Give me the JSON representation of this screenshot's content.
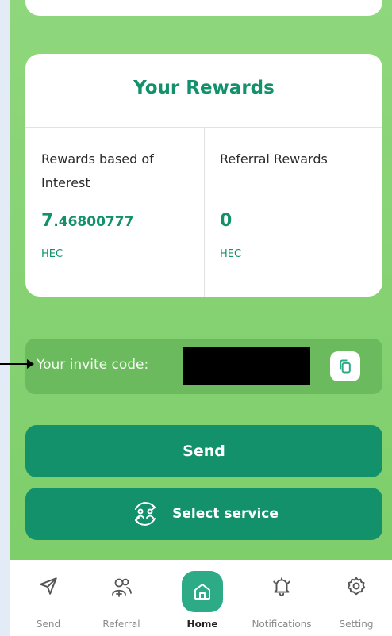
{
  "rewards": {
    "title": "Your Rewards",
    "interest": {
      "label": "Rewards based of Interest",
      "value_int": "7",
      "value_dec": ".46800777",
      "unit": "HEC"
    },
    "referral": {
      "label": "Referral Rewards",
      "value": "0",
      "unit": "HEC"
    }
  },
  "invite": {
    "label": "Your invite code:",
    "copy_icon": "copy-icon"
  },
  "actions": {
    "send_label": "Send",
    "service_label": "Select service",
    "service_icon": "swap-users-icon"
  },
  "nav": {
    "items": [
      {
        "label": "Send",
        "icon": "send-icon"
      },
      {
        "label": "Referral",
        "icon": "add-user-icon"
      },
      {
        "label": "Home",
        "icon": "home-icon",
        "active": true
      },
      {
        "label": "Notifications",
        "icon": "bell-icon"
      },
      {
        "label": "Setting",
        "icon": "gear-icon"
      }
    ]
  },
  "colors": {
    "accent": "#12916b",
    "background_green": "#86d273",
    "home_active": "#2cab86"
  }
}
